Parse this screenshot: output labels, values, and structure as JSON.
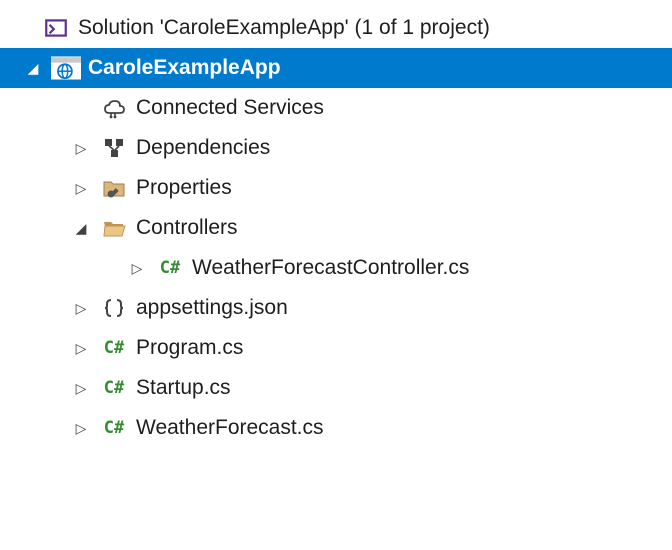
{
  "solution": {
    "label": "Solution 'CaroleExampleApp' (1 of 1 project)"
  },
  "project": {
    "label": "CaroleExampleApp"
  },
  "nodes": {
    "connectedServices": "Connected Services",
    "dependencies": "Dependencies",
    "properties": "Properties",
    "controllers": "Controllers",
    "controllersChild": "WeatherForecastController.cs",
    "appsettings": "appsettings.json",
    "program": "Program.cs",
    "startup": "Startup.cs",
    "weatherForecast": "WeatherForecast.cs"
  },
  "csharpIconText": "C#"
}
